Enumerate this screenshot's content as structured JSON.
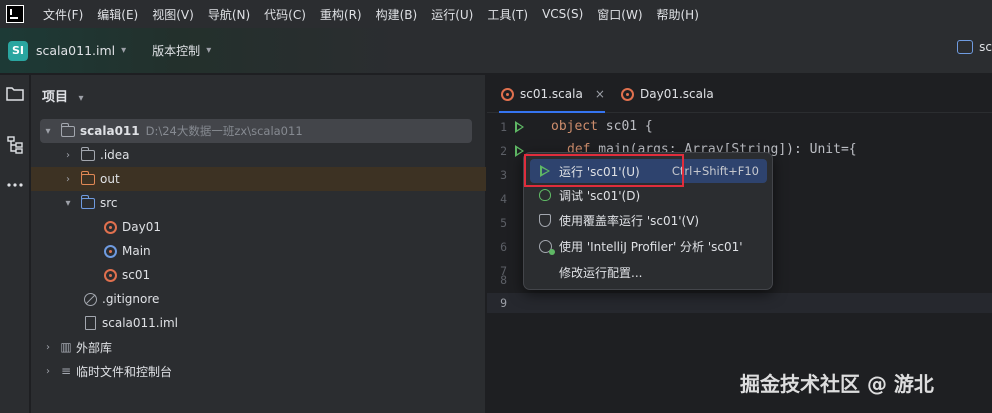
{
  "menu": [
    "文件(F)",
    "编辑(E)",
    "视图(V)",
    "导航(N)",
    "代码(C)",
    "重构(R)",
    "构建(B)",
    "运行(U)",
    "工具(T)",
    "VCS(S)",
    "窗口(W)",
    "帮助(H)"
  ],
  "toolbar": {
    "project_badge": "SI",
    "project_name": "scala011.iml",
    "vcs_label": "版本控制",
    "right_label": "sc"
  },
  "project_panel": {
    "title": "项目",
    "tree": [
      {
        "label": "scala011",
        "path": "D:\\24大数据一班zx\\scala011"
      },
      {
        "label": ".idea"
      },
      {
        "label": "out"
      },
      {
        "label": "src"
      },
      {
        "label": "Day01"
      },
      {
        "label": "Main"
      },
      {
        "label": "sc01"
      },
      {
        "label": ".gitignore"
      },
      {
        "label": "scala011.iml"
      },
      {
        "label": "外部库"
      },
      {
        "label": "临时文件和控制台"
      }
    ]
  },
  "editor": {
    "tabs": [
      {
        "label": "sc01.scala",
        "close": "×"
      },
      {
        "label": "Day01.scala"
      }
    ],
    "line_numbers": [
      "1",
      "2",
      "3",
      "4",
      "5",
      "6",
      "7",
      "8",
      "9"
    ],
    "code": {
      "line1_kw": "object",
      "line1_rest": " sc01 {",
      "line2_kw": "def",
      "line2_rest": " main(args: Array[String]): Unit={"
    }
  },
  "context_menu": {
    "items": [
      {
        "label": "运行 'sc01'(U)",
        "shortcut": "Ctrl+Shift+F10"
      },
      {
        "label": "调试 'sc01'(D)"
      },
      {
        "label": "使用覆盖率运行 'sc01'(V)"
      },
      {
        "label": "使用 'IntelliJ Profiler' 分析  'sc01'"
      },
      {
        "label": "修改运行配置..."
      }
    ]
  },
  "watermark": "掘金技术社区 @ 游北",
  "colors": {
    "accent": "#3574f0",
    "run_green": "#5fb865",
    "highlight_box": "#e02d3c",
    "scala_orange": "#e0704e"
  }
}
